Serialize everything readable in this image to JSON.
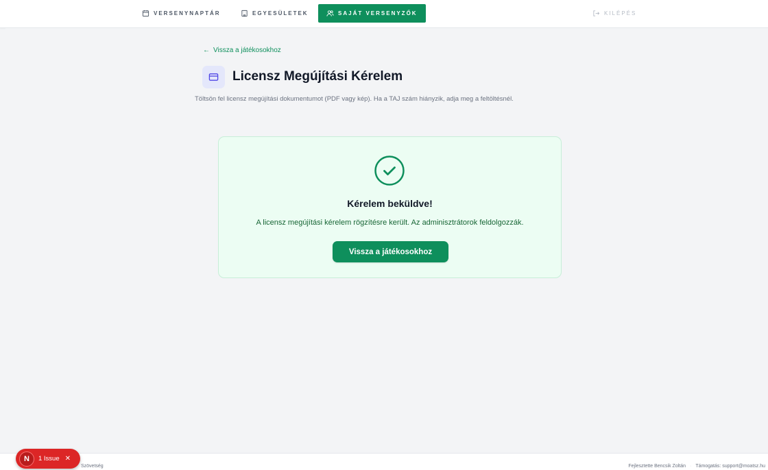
{
  "nav": {
    "items": [
      {
        "label": "Versenynaptár",
        "icon": "calendar-icon"
      },
      {
        "label": "Egyesületek",
        "icon": "building-icon"
      },
      {
        "label": "Saját versenyzők",
        "icon": "users-icon",
        "active": true
      }
    ],
    "logout_label": "Kilépés",
    "logout_icon": "logout-icon"
  },
  "page": {
    "back_label": "Vissza a játékosokhoz",
    "title": "Licensz Megújítási Kérelem",
    "title_icon": "credit-card-icon",
    "description": "Töltsön fel licensz megújítási dokumentumot (PDF vagy kép). Ha a TAJ szám hiányzik, adja meg a feltöltésnél."
  },
  "success": {
    "icon": "check-circle-icon",
    "title": "Kérelem beküldve!",
    "message": "A licensz megújítási kérelem rögzítésre került. Az adminisztrátorok feldolgozzák.",
    "button_label": "Vissza a játékosokhoz"
  },
  "footer": {
    "left_text": "Szövetség",
    "developer_text": "Fejlesztette Bencsik Zoltán",
    "support_text": "Támogatás: support@moatsz.hu"
  },
  "issue_badge": {
    "letter": "N",
    "label": "1 Issue",
    "close_glyph": "✕"
  },
  "colors": {
    "brand": "#0e8f5c",
    "success_bg": "#ecfdf3",
    "success_text": "#166534",
    "error_badge": "#dc2626"
  }
}
